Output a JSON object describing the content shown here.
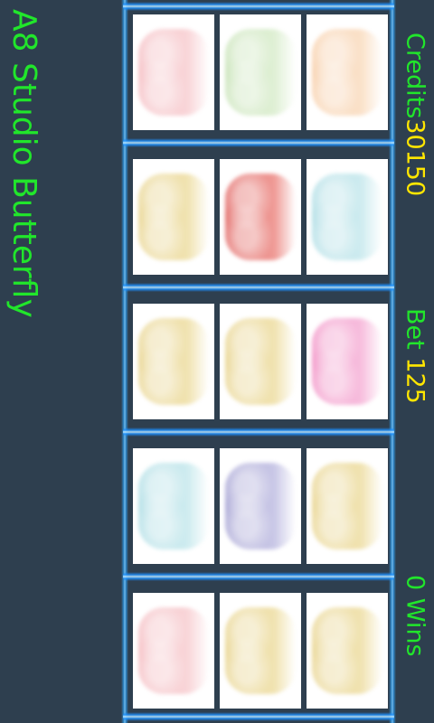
{
  "app_title": "A8 Studio Butterfly",
  "credits": {
    "label": "Credits",
    "value": "30150"
  },
  "bet": {
    "label": "Bet ",
    "value": "125"
  },
  "wins": {
    "value": "0",
    "label": " Wins"
  },
  "reels": [
    [
      {
        "name": "pink-butterfly-icon",
        "color": "#f2a7ae",
        "color2": "#f7c8cc"
      },
      {
        "name": "green-butterfly-icon",
        "color": "#b7dba1",
        "color2": "#d5ebc7"
      },
      {
        "name": "orange-butterfly-icon",
        "color": "#f6c08f",
        "color2": "#f9d8b8"
      }
    ],
    [
      {
        "name": "yellow-butterfly-icon",
        "color": "#e2c76b",
        "color2": "#ecda98"
      },
      {
        "name": "red-butterfly-icon",
        "color": "#d8332f",
        "color2": "#ea7a74"
      },
      {
        "name": "cyan-butterfly-icon",
        "color": "#95d3dd",
        "color2": "#bfe6eb"
      }
    ],
    [
      {
        "name": "yellow-butterfly-icon",
        "color": "#e2c76b",
        "color2": "#ecda98"
      },
      {
        "name": "yellow-butterfly-icon",
        "color": "#e2c76b",
        "color2": "#ecda98"
      },
      {
        "name": "magenta-butterfly-icon",
        "color": "#ee6fb4",
        "color2": "#f5a9d3"
      }
    ],
    [
      {
        "name": "cyan-butterfly-icon",
        "color": "#95d3dd",
        "color2": "#bfe6eb"
      },
      {
        "name": "purple-butterfly-icon",
        "color": "#8a86c6",
        "color2": "#b8b6df"
      },
      {
        "name": "yellow-butterfly-icon",
        "color": "#e2c76b",
        "color2": "#ecda98"
      }
    ],
    [
      {
        "name": "pink-butterfly-icon",
        "color": "#f2a7ae",
        "color2": "#f7c8cc"
      },
      {
        "name": "yellow-butterfly-icon",
        "color": "#e2c76b",
        "color2": "#ecda98"
      },
      {
        "name": "yellow-butterfly-icon",
        "color": "#e2c76b",
        "color2": "#ecda98"
      }
    ]
  ]
}
